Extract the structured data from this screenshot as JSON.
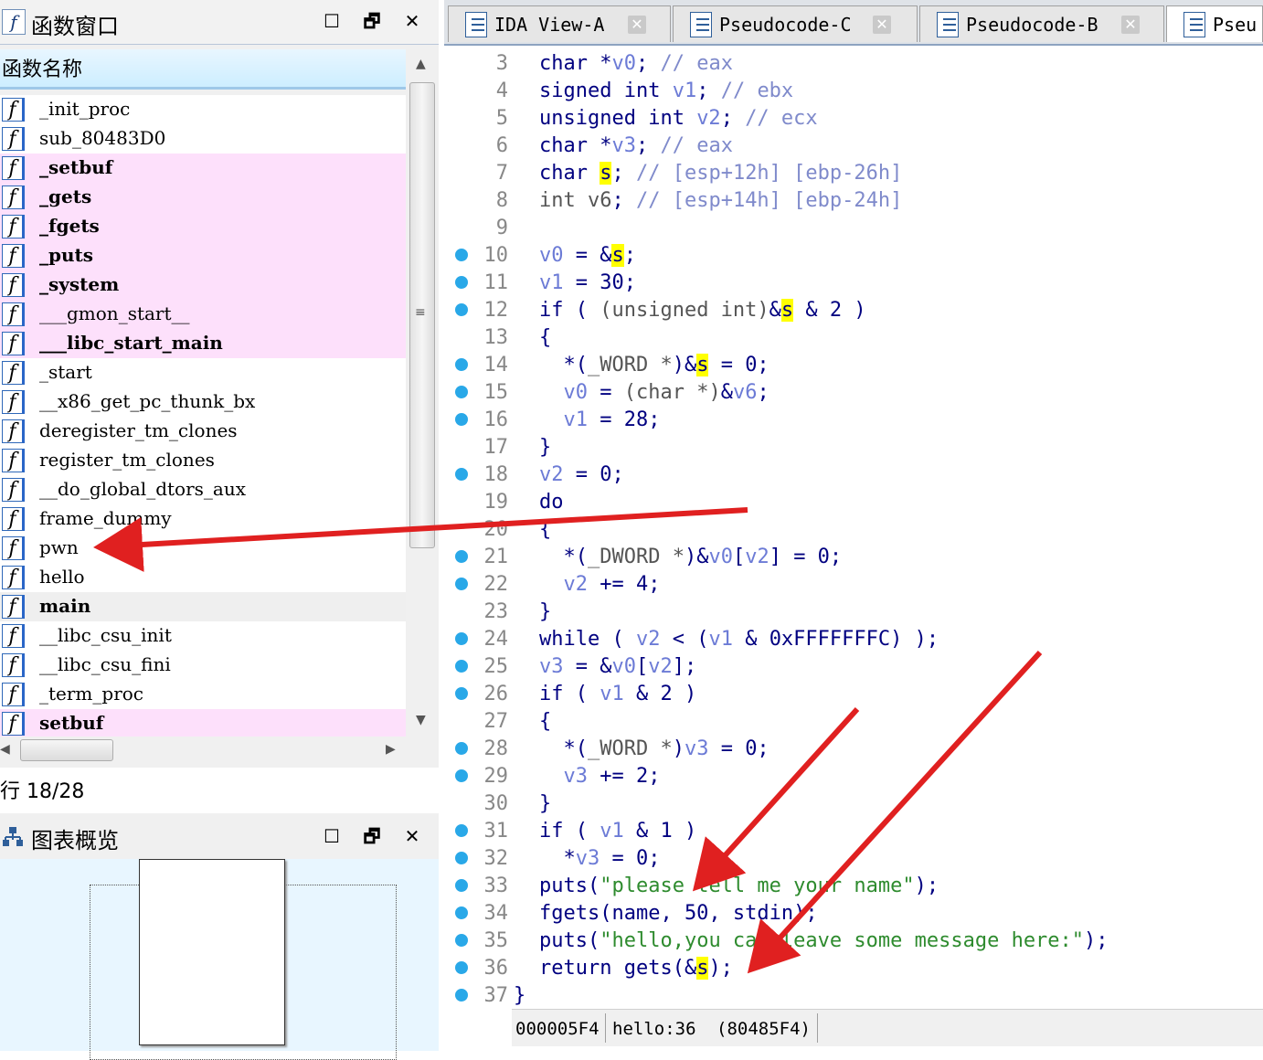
{
  "functions_window": {
    "title": "函数窗口",
    "column_header": "函数名称",
    "items": [
      {
        "name": "_init_proc",
        "style": "normal"
      },
      {
        "name": "sub_80483D0",
        "style": "normal"
      },
      {
        "name": "_setbuf",
        "style": "pink"
      },
      {
        "name": "_gets",
        "style": "pink"
      },
      {
        "name": "_fgets",
        "style": "pink"
      },
      {
        "name": "_puts",
        "style": "pink"
      },
      {
        "name": "_system",
        "style": "pink"
      },
      {
        "name": "___gmon_start__",
        "style": "pink-normal"
      },
      {
        "name": "___libc_start_main",
        "style": "pink"
      },
      {
        "name": "_start",
        "style": "normal"
      },
      {
        "name": "__x86_get_pc_thunk_bx",
        "style": "normal"
      },
      {
        "name": "deregister_tm_clones",
        "style": "normal"
      },
      {
        "name": "register_tm_clones",
        "style": "normal"
      },
      {
        "name": "__do_global_dtors_aux",
        "style": "normal"
      },
      {
        "name": "frame_dummy",
        "style": "normal"
      },
      {
        "name": "pwn",
        "style": "normal"
      },
      {
        "name": "hello",
        "style": "normal"
      },
      {
        "name": "main",
        "style": "selected"
      },
      {
        "name": "__libc_csu_init",
        "style": "normal"
      },
      {
        "name": "__libc_csu_fini",
        "style": "normal"
      },
      {
        "name": "_term_proc",
        "style": "normal"
      },
      {
        "name": "setbuf",
        "style": "pink"
      }
    ],
    "row_count": "行 18/28",
    "icon_glyph": "f",
    "btn_maximize": "☐",
    "btn_float": "🗗",
    "btn_close": "✕"
  },
  "overview_window": {
    "title": "图表概览"
  },
  "tabs": [
    {
      "label": "IDA View-A",
      "active": false
    },
    {
      "label": "Pseudocode-C",
      "active": false
    },
    {
      "label": "Pseudocode-B",
      "active": false
    },
    {
      "label": "Pseu",
      "active": true
    }
  ],
  "tab_close_glyph": "✕",
  "code": [
    {
      "ln": "3",
      "dot": false,
      "tokens": [
        [
          "kw",
          "char *"
        ],
        [
          "var",
          "v0"
        ],
        [
          "kw",
          "; "
        ],
        [
          "cm",
          "// eax"
        ]
      ]
    },
    {
      "ln": "4",
      "dot": false,
      "tokens": [
        [
          "kw",
          "signed int "
        ],
        [
          "var",
          "v1"
        ],
        [
          "kw",
          "; "
        ],
        [
          "cm",
          "// ebx"
        ]
      ]
    },
    {
      "ln": "5",
      "dot": false,
      "tokens": [
        [
          "kw",
          "unsigned int "
        ],
        [
          "var",
          "v2"
        ],
        [
          "kw",
          "; "
        ],
        [
          "cm",
          "// ecx"
        ]
      ]
    },
    {
      "ln": "6",
      "dot": false,
      "tokens": [
        [
          "kw",
          "char *"
        ],
        [
          "var",
          "v3"
        ],
        [
          "kw",
          "; "
        ],
        [
          "cm",
          "// eax"
        ]
      ]
    },
    {
      "ln": "7",
      "dot": false,
      "tokens": [
        [
          "kw",
          "char "
        ],
        [
          "hl",
          "s"
        ],
        [
          "kw",
          "; "
        ],
        [
          "cm",
          "// [esp+12h] [ebp-26h]"
        ]
      ]
    },
    {
      "ln": "8",
      "dot": false,
      "tokens": [
        [
          "typ",
          "int "
        ],
        [
          "typ",
          "v6"
        ],
        [
          "kw",
          "; "
        ],
        [
          "cm",
          "// [esp+14h] [ebp-24h]"
        ]
      ]
    },
    {
      "ln": "9",
      "dot": false,
      "tokens": []
    },
    {
      "ln": "10",
      "dot": true,
      "tokens": [
        [
          "var",
          "v0"
        ],
        [
          "kw",
          " = &"
        ],
        [
          "hl",
          "s"
        ],
        [
          "kw",
          ";"
        ]
      ]
    },
    {
      "ln": "11",
      "dot": true,
      "tokens": [
        [
          "var",
          "v1"
        ],
        [
          "kw",
          " = 30;"
        ]
      ]
    },
    {
      "ln": "12",
      "dot": true,
      "tokens": [
        [
          "kw",
          "if ( "
        ],
        [
          "typ",
          "(unsigned int)"
        ],
        [
          "kw",
          "&"
        ],
        [
          "hl",
          "s"
        ],
        [
          "kw",
          " & 2 )"
        ]
      ]
    },
    {
      "ln": "13",
      "dot": false,
      "tokens": [
        [
          "kw",
          "{"
        ]
      ]
    },
    {
      "ln": "14",
      "dot": true,
      "tokens": [
        [
          "kw",
          "  *("
        ],
        [
          "typ",
          "_WORD *"
        ],
        [
          "kw",
          ")&"
        ],
        [
          "hl",
          "s"
        ],
        [
          "kw",
          " = 0;"
        ]
      ]
    },
    {
      "ln": "15",
      "dot": true,
      "tokens": [
        [
          "kw",
          "  "
        ],
        [
          "var",
          "v0"
        ],
        [
          "kw",
          " = "
        ],
        [
          "typ",
          "(char *)"
        ],
        [
          "kw",
          "&"
        ],
        [
          "var",
          "v6"
        ],
        [
          "kw",
          ";"
        ]
      ]
    },
    {
      "ln": "16",
      "dot": true,
      "tokens": [
        [
          "kw",
          "  "
        ],
        [
          "var",
          "v1"
        ],
        [
          "kw",
          " = 28;"
        ]
      ]
    },
    {
      "ln": "17",
      "dot": false,
      "tokens": [
        [
          "kw",
          "}"
        ]
      ]
    },
    {
      "ln": "18",
      "dot": true,
      "tokens": [
        [
          "var",
          "v2"
        ],
        [
          "kw",
          " = 0;"
        ]
      ]
    },
    {
      "ln": "19",
      "dot": false,
      "tokens": [
        [
          "kw",
          "do"
        ]
      ]
    },
    {
      "ln": "20",
      "dot": false,
      "tokens": [
        [
          "kw",
          "{"
        ]
      ]
    },
    {
      "ln": "21",
      "dot": true,
      "tokens": [
        [
          "kw",
          "  *("
        ],
        [
          "typ",
          "_DWORD *"
        ],
        [
          "kw",
          ")&"
        ],
        [
          "var",
          "v0"
        ],
        [
          "kw",
          "["
        ],
        [
          "var",
          "v2"
        ],
        [
          "kw",
          "] = 0;"
        ]
      ]
    },
    {
      "ln": "22",
      "dot": true,
      "tokens": [
        [
          "kw",
          "  "
        ],
        [
          "var",
          "v2"
        ],
        [
          "kw",
          " += 4;"
        ]
      ]
    },
    {
      "ln": "23",
      "dot": false,
      "tokens": [
        [
          "kw",
          "}"
        ]
      ]
    },
    {
      "ln": "24",
      "dot": true,
      "tokens": [
        [
          "kw",
          "while ( "
        ],
        [
          "var",
          "v2"
        ],
        [
          "kw",
          " < ("
        ],
        [
          "var",
          "v1"
        ],
        [
          "kw",
          " & 0xFFFFFFFC) );"
        ]
      ]
    },
    {
      "ln": "25",
      "dot": true,
      "tokens": [
        [
          "var",
          "v3"
        ],
        [
          "kw",
          " = &"
        ],
        [
          "var",
          "v0"
        ],
        [
          "kw",
          "["
        ],
        [
          "var",
          "v2"
        ],
        [
          "kw",
          "];"
        ]
      ]
    },
    {
      "ln": "26",
      "dot": true,
      "tokens": [
        [
          "kw",
          "if ( "
        ],
        [
          "var",
          "v1"
        ],
        [
          "kw",
          " & 2 )"
        ]
      ]
    },
    {
      "ln": "27",
      "dot": false,
      "tokens": [
        [
          "kw",
          "{"
        ]
      ]
    },
    {
      "ln": "28",
      "dot": true,
      "tokens": [
        [
          "kw",
          "  *("
        ],
        [
          "typ",
          "_WORD *"
        ],
        [
          "kw",
          ")"
        ],
        [
          "var",
          "v3"
        ],
        [
          "kw",
          " = 0;"
        ]
      ]
    },
    {
      "ln": "29",
      "dot": true,
      "tokens": [
        [
          "kw",
          "  "
        ],
        [
          "var",
          "v3"
        ],
        [
          "kw",
          " += 2;"
        ]
      ]
    },
    {
      "ln": "30",
      "dot": false,
      "tokens": [
        [
          "kw",
          "}"
        ]
      ]
    },
    {
      "ln": "31",
      "dot": true,
      "tokens": [
        [
          "kw",
          "if ( "
        ],
        [
          "var",
          "v1"
        ],
        [
          "kw",
          " & 1 )"
        ]
      ]
    },
    {
      "ln": "32",
      "dot": true,
      "tokens": [
        [
          "kw",
          "  *"
        ],
        [
          "var",
          "v3"
        ],
        [
          "kw",
          " = 0;"
        ]
      ]
    },
    {
      "ln": "33",
      "dot": true,
      "tokens": [
        [
          "kw",
          "puts("
        ],
        [
          "str",
          "\"please tell me your name\""
        ],
        [
          "kw",
          ");"
        ]
      ]
    },
    {
      "ln": "34",
      "dot": true,
      "tokens": [
        [
          "kw",
          "fgets(name, 50, stdin);"
        ]
      ]
    },
    {
      "ln": "35",
      "dot": true,
      "tokens": [
        [
          "kw",
          "puts("
        ],
        [
          "str",
          "\"hello,you can leave some message here:\""
        ],
        [
          "kw",
          ");"
        ]
      ]
    },
    {
      "ln": "36",
      "dot": true,
      "tokens": [
        [
          "kw",
          "return gets(&"
        ],
        [
          "hl",
          "s"
        ],
        [
          "kw",
          ");"
        ]
      ]
    },
    {
      "ln": "37",
      "dot": true,
      "tokens": [
        [
          "kw",
          "}"
        ]
      ]
    }
  ],
  "status_bar": {
    "offset": "000005F4",
    "location": "hello:36",
    "address": "(80485F4)"
  },
  "colors": {
    "annotation_arrow": "#e02020",
    "breakpoint_dot": "#29a8e8",
    "pink_row": "#fde0fb"
  }
}
